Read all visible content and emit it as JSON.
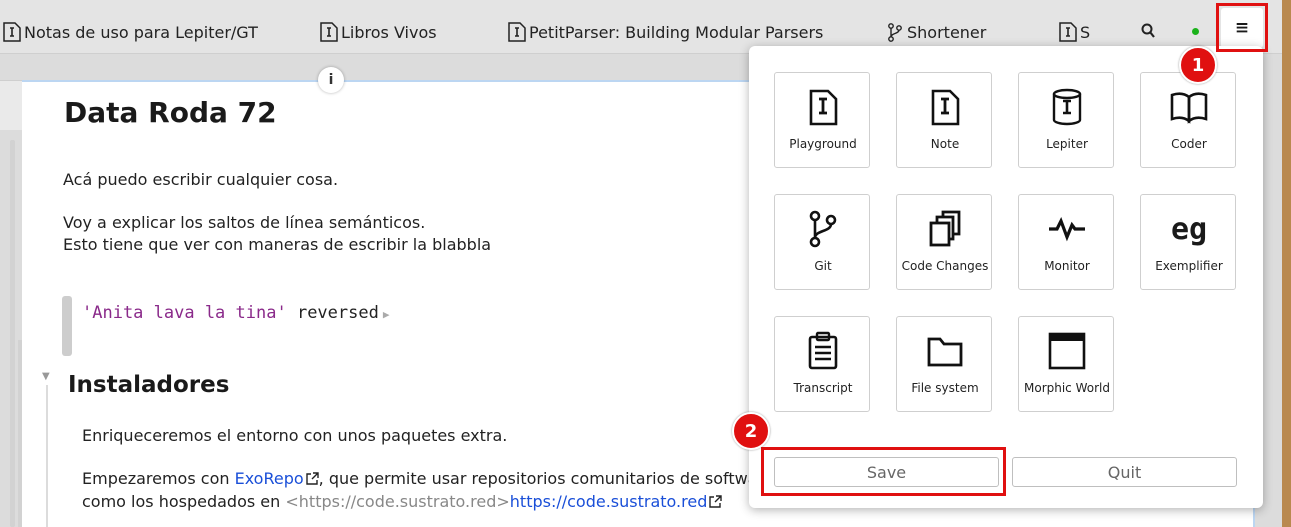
{
  "tabs": [
    {
      "label": "Notas de uso para Lepiter/GT",
      "icon": "page-icon"
    },
    {
      "label": "Libros Vivos",
      "icon": "page-icon"
    },
    {
      "label": "PetitParser: Building Modular Parsers",
      "icon": "page-icon"
    },
    {
      "label": "Shortener",
      "icon": "git-branch-icon"
    },
    {
      "label": "S",
      "icon": "page-icon"
    }
  ],
  "toolbar": {
    "menu_label": "≡"
  },
  "colors": {
    "accent_red": "#e01010",
    "status_green": "#1bb21b",
    "link": "#1a4fd8",
    "code_string": "#8a2a8a"
  },
  "document": {
    "info_label": "i",
    "title": "Data Roda 72",
    "para1": "Acá puedo escribir cualquier cosa.",
    "para2": "Voy a explicar los saltos de línea semánticos.",
    "para3": "Esto tiene que ver con maneras de escribir  la blabbla",
    "code": {
      "string": "'Anita lava la tina'",
      "message": "reversed",
      "run": "▶"
    },
    "section_title": "Instaladores",
    "sec_para1": "Enriqueceremos el entorno con unos paquetes extra.",
    "sec_para2_pre": "Empezaremos con ",
    "sec_para2_link": "ExoRepo",
    "sec_para2_post": ", que permite usar repositorios comunitarios de software,",
    "sec_para3_pre": "como los hospedados en ",
    "sec_para3_raw": "<https://code.sustrato.red>",
    "sec_para3_link": "https://code.sustrato.red"
  },
  "popup": {
    "tiles": [
      {
        "label": "Playground",
        "icon": "playground-icon"
      },
      {
        "label": "Note",
        "icon": "note-icon"
      },
      {
        "label": "Lepiter",
        "icon": "lepiter-icon"
      },
      {
        "label": "Coder",
        "icon": "book-icon"
      },
      {
        "label": "Git",
        "icon": "git-icon"
      },
      {
        "label": "Code Changes",
        "icon": "copy-icon"
      },
      {
        "label": "Monitor",
        "icon": "pulse-icon"
      },
      {
        "label": "Exemplifier",
        "icon": "eg-icon"
      },
      {
        "label": "Transcript",
        "icon": "clipboard-icon"
      },
      {
        "label": "File system",
        "icon": "folder-icon"
      },
      {
        "label": "Morphic World",
        "icon": "window-icon"
      }
    ],
    "save_label": "Save",
    "quit_label": "Quit",
    "eg_text": "eg"
  },
  "annotations": {
    "badge1": "1",
    "badge2": "2"
  }
}
